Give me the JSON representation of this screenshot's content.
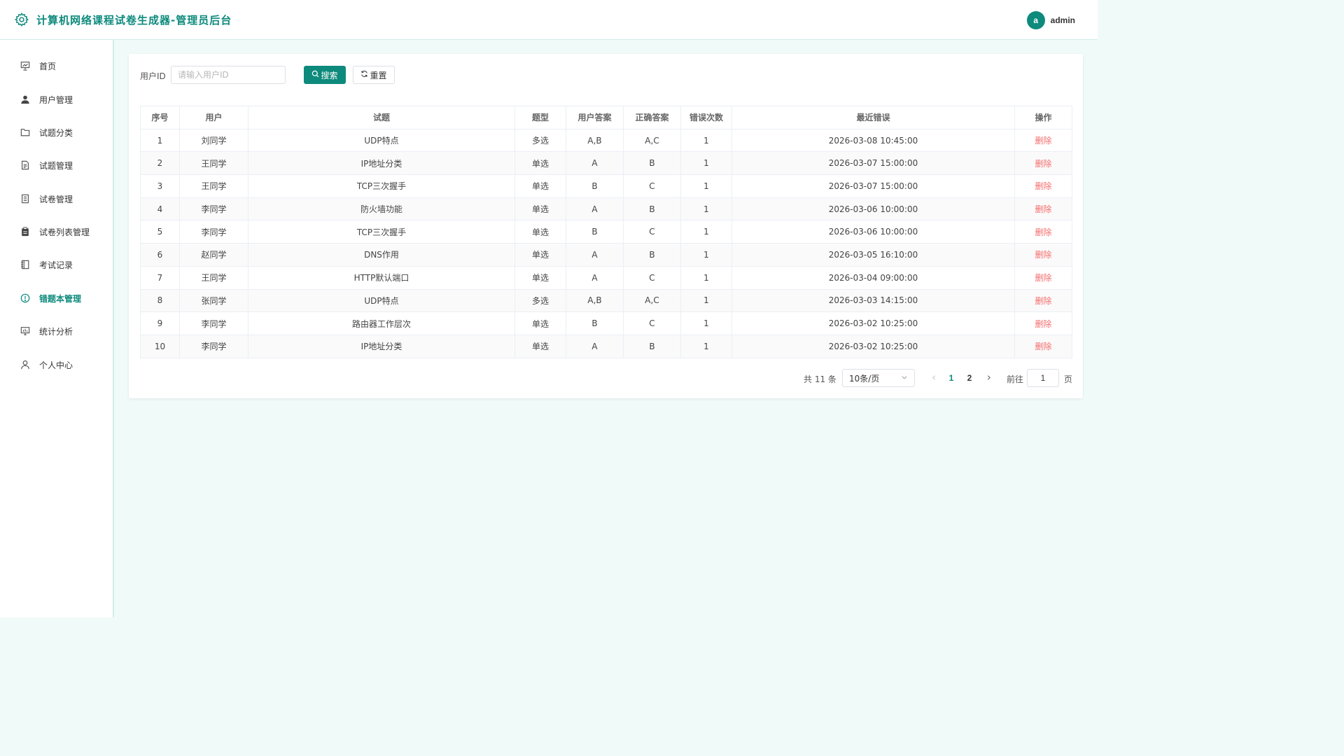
{
  "header": {
    "title": "计算机网络课程试卷生成器-管理员后台",
    "avatar_letter": "a",
    "username": "admin"
  },
  "colors": {
    "accent": "#0d8a7c",
    "danger": "#f56c6c"
  },
  "sidebar": {
    "items": [
      {
        "label": "首页",
        "icon": "presentation-icon"
      },
      {
        "label": "用户管理",
        "icon": "user-filled-icon"
      },
      {
        "label": "试题分类",
        "icon": "folder-icon"
      },
      {
        "label": "试题管理",
        "icon": "document-icon"
      },
      {
        "label": "试卷管理",
        "icon": "tickets-icon"
      },
      {
        "label": "试卷列表管理",
        "icon": "clipboard-icon"
      },
      {
        "label": "考试记录",
        "icon": "notebook-icon"
      },
      {
        "label": "错题本管理",
        "icon": "warning-icon"
      },
      {
        "label": "统计分析",
        "icon": "monitor-chart-icon"
      },
      {
        "label": "个人中心",
        "icon": "user-icon"
      }
    ],
    "active_index": 7
  },
  "filter": {
    "label": "用户ID",
    "placeholder": "请输入用户ID",
    "value": "",
    "search_label": "搜索",
    "reset_label": "重置"
  },
  "table": {
    "columns": [
      "序号",
      "用户",
      "试题",
      "题型",
      "用户答案",
      "正确答案",
      "错误次数",
      "最近错误",
      "操作"
    ],
    "rows": [
      [
        "1",
        "刘同学",
        "UDP特点",
        "多选",
        "A,B",
        "A,C",
        "1",
        "2026-03-08 10:45:00",
        "删除"
      ],
      [
        "2",
        "王同学",
        "IP地址分类",
        "单选",
        "A",
        "B",
        "1",
        "2026-03-07 15:00:00",
        "删除"
      ],
      [
        "3",
        "王同学",
        "TCP三次握手",
        "单选",
        "B",
        "C",
        "1",
        "2026-03-07 15:00:00",
        "删除"
      ],
      [
        "4",
        "李同学",
        "防火墙功能",
        "单选",
        "A",
        "B",
        "1",
        "2026-03-06 10:00:00",
        "删除"
      ],
      [
        "5",
        "李同学",
        "TCP三次握手",
        "单选",
        "B",
        "C",
        "1",
        "2026-03-06 10:00:00",
        "删除"
      ],
      [
        "6",
        "赵同学",
        "DNS作用",
        "单选",
        "A",
        "B",
        "1",
        "2026-03-05 16:10:00",
        "删除"
      ],
      [
        "7",
        "王同学",
        "HTTP默认端口",
        "单选",
        "A",
        "C",
        "1",
        "2026-03-04 09:00:00",
        "删除"
      ],
      [
        "8",
        "张同学",
        "UDP特点",
        "多选",
        "A,B",
        "A,C",
        "1",
        "2026-03-03 14:15:00",
        "删除"
      ],
      [
        "9",
        "李同学",
        "路由器工作层次",
        "单选",
        "B",
        "C",
        "1",
        "2026-03-02 10:25:00",
        "删除"
      ],
      [
        "10",
        "李同学",
        "IP地址分类",
        "单选",
        "A",
        "B",
        "1",
        "2026-03-02 10:25:00",
        "删除"
      ]
    ]
  },
  "pagination": {
    "total_text": "共 11 条",
    "page_size": "10条/页",
    "pages": [
      "1",
      "2"
    ],
    "current_page": "1",
    "goto_label": "前往",
    "goto_value": "1",
    "goto_suffix": "页"
  }
}
